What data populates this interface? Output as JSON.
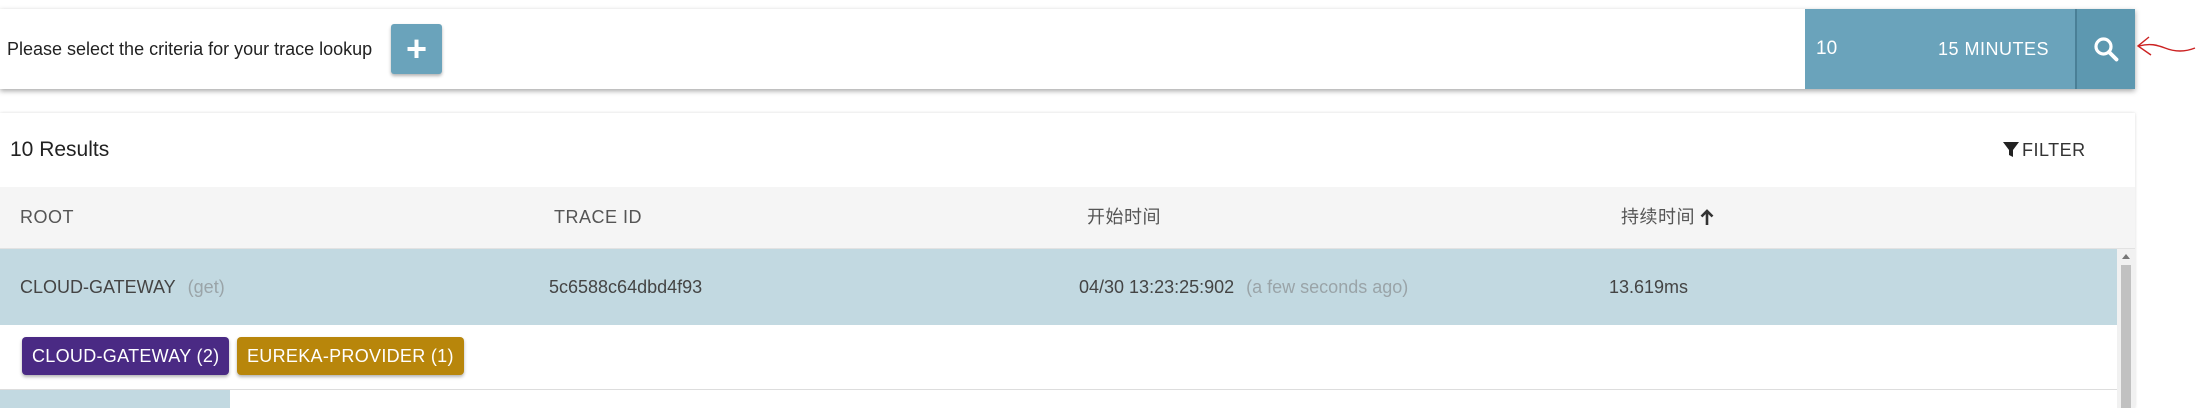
{
  "search_bar": {
    "prompt": "Please select the criteria for your trace lookup",
    "add_button_glyph": "+",
    "limit": "10",
    "lookback": "15 MINUTES",
    "search_icon": "search-icon",
    "button_color": "#6aa3bb"
  },
  "results": {
    "count_label": "10 Results",
    "filter_label": "FILTER",
    "columns": {
      "root": "ROOT",
      "trace_id": "TRACE ID",
      "start_time": "开始时间",
      "duration": "持续时间"
    },
    "rows": [
      {
        "root_service": "CLOUD-GATEWAY",
        "method": "(get)",
        "trace_id": "5c6588c64dbd4f93",
        "start_time": "04/30 13:23:25:902",
        "relative_time": "(a few seconds ago)",
        "duration": "13.619ms",
        "tags": [
          {
            "label": "CLOUD-GATEWAY (2)",
            "color": "#4a2a84"
          },
          {
            "label": "EUREKA-PROVIDER (1)",
            "color": "#b8860b"
          }
        ]
      }
    ]
  },
  "colors": {
    "selected_row": "#c2d9e1",
    "accent": "#6aa3bb",
    "annotation": "#cc2222"
  }
}
